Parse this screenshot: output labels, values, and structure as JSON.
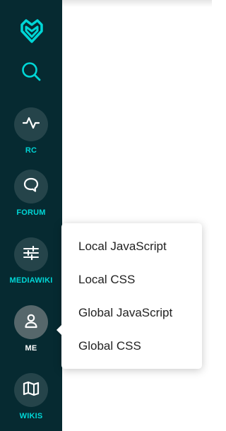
{
  "sidebar": {
    "logo_icon": "fandom-heart-icon",
    "search_icon": "search-icon",
    "items": [
      {
        "label": "RC",
        "icon": "activity-icon",
        "active": false
      },
      {
        "label": "FORUM",
        "icon": "speech-bubble-icon",
        "active": false
      },
      {
        "label": "MEDIAWIKI",
        "icon": "sliders-icon",
        "active": false
      },
      {
        "label": "ME",
        "icon": "user-icon",
        "active": true
      },
      {
        "label": "WIKIS",
        "icon": "map-icon",
        "active": false
      }
    ]
  },
  "popup_menu": {
    "items": [
      {
        "label": "Local JavaScript"
      },
      {
        "label": "Local CSS"
      },
      {
        "label": "Global JavaScript"
      },
      {
        "label": "Global CSS"
      }
    ]
  },
  "colors": {
    "sidebar_bg": "#062a31",
    "accent": "#00d6d6",
    "circle_bg": "#25444a",
    "circle_active_bg": "#56676b",
    "popup_text": "#222222"
  }
}
